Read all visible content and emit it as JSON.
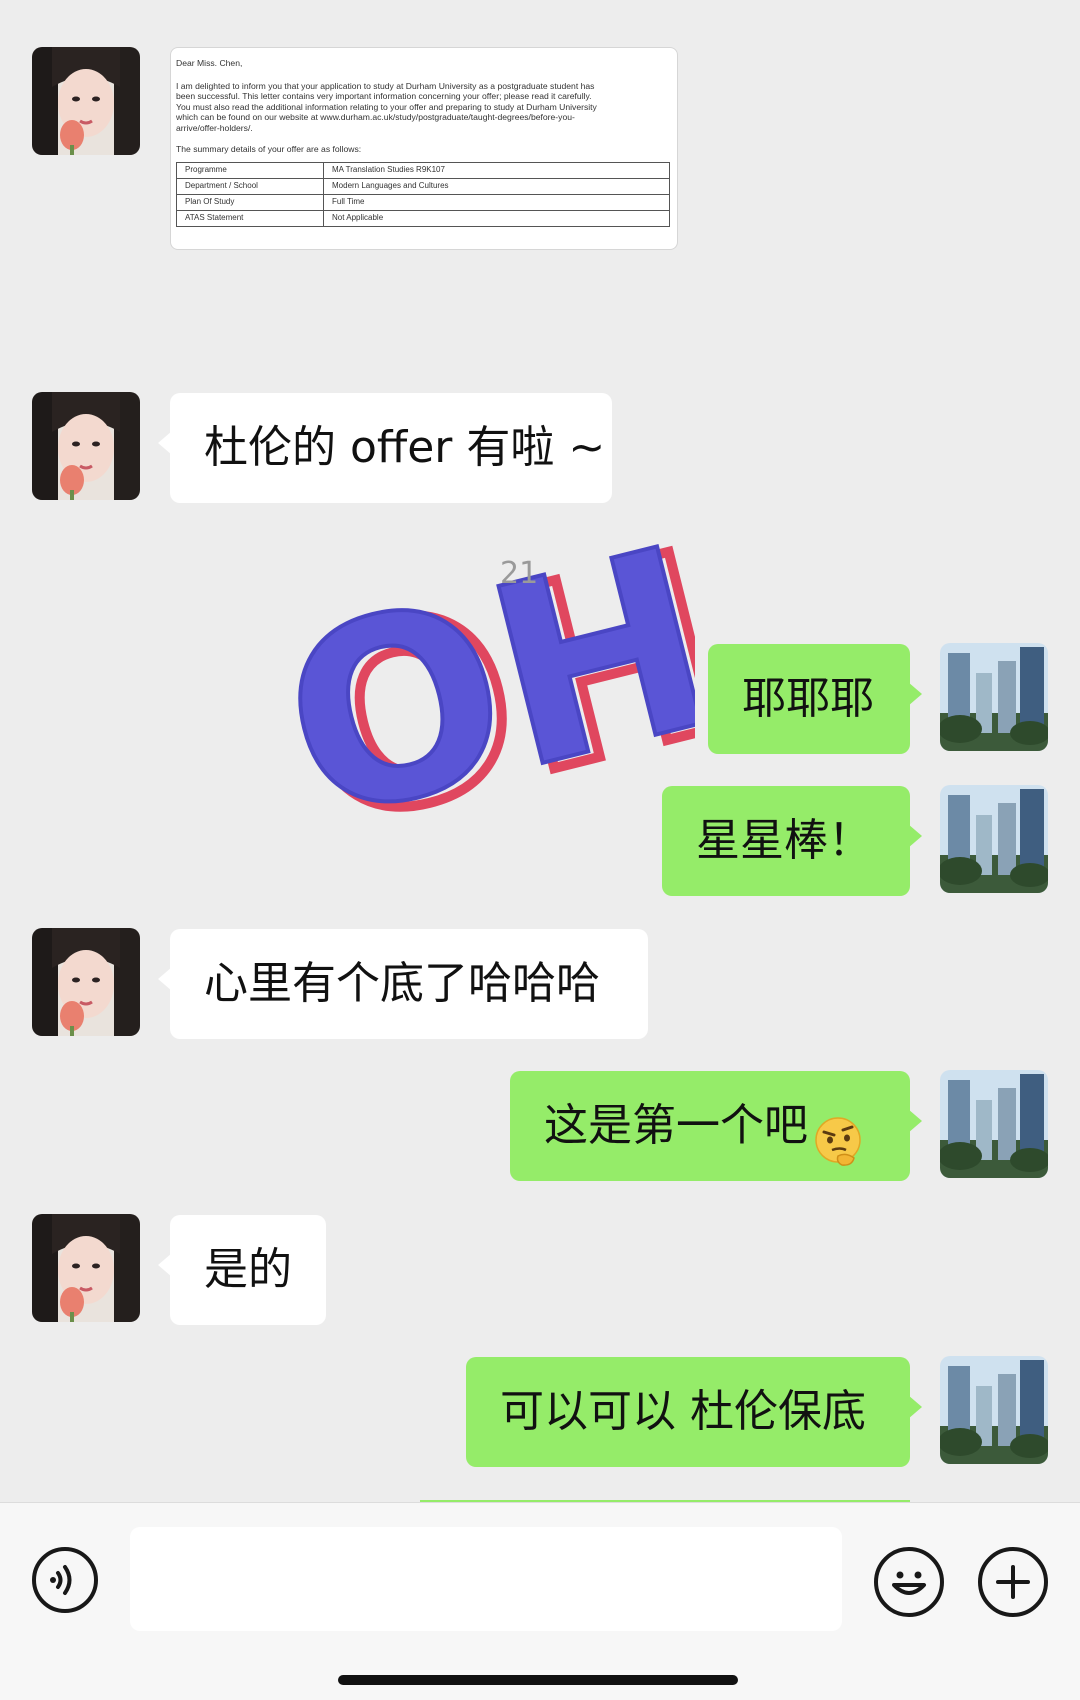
{
  "document": {
    "greeting": "Dear Miss. Chen,",
    "paragraph": [
      "I am delighted to inform you that your application to study at Durham University as a postgraduate student has",
      "been successful. This letter contains very important information concerning your offer; please read it carefully.",
      "You must also read the additional information relating to your offer and preparing to study at Durham University",
      "which can be found on our website at www.durham.ac.uk/study/postgraduate/taught-degrees/before-you-",
      "arrive/offer-holders/."
    ],
    "summary_intro": "The summary details of your offer are as follows:",
    "table": [
      {
        "label": "Programme",
        "value": "MA Translation Studies R9K107"
      },
      {
        "label": "Department / School",
        "value": "Modern Languages and Cultures"
      },
      {
        "label": "Plan Of Study",
        "value": "Full Time"
      },
      {
        "label": "ATAS Statement",
        "value": "Not Applicable"
      }
    ]
  },
  "messages": [
    {
      "side": "in",
      "text": "杜伦的 offer 有啦 ~"
    },
    {
      "side": "out",
      "text": "耶耶耶"
    },
    {
      "side": "out",
      "text": "星星棒！"
    },
    {
      "side": "in",
      "text": "心里有个底了哈哈哈"
    },
    {
      "side": "out",
      "text": "这是第一个吧"
    },
    {
      "side": "in",
      "text": "是的"
    },
    {
      "side": "out",
      "text": "可以可以 杜伦保底"
    }
  ],
  "sticker": {
    "text": "OH!",
    "overlay_number": "21"
  },
  "emoji": {
    "name": "thinking-face-icon"
  },
  "icons": {
    "voice": "voice-icon",
    "emoji_button": "smiley-icon",
    "more": "plus-icon"
  },
  "colors": {
    "background": "#ededed",
    "incoming_bubble": "#ffffff",
    "outgoing_bubble": "#95ec69",
    "sticker_blue": "#5a55d6",
    "sticker_red": "#e0475f"
  },
  "input": {
    "value": "",
    "placeholder": ""
  }
}
